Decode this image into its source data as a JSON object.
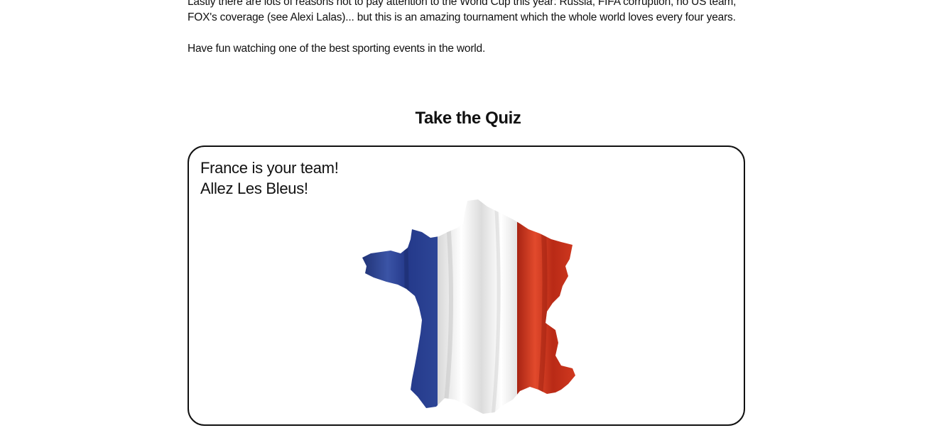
{
  "article": {
    "paragraph_1": "Lastly there are lots of reasons not to pay attention to the World Cup this year: Russia, FIFA corruption, no US team, FOX's coverage (see Alexi Lalas)... but this is an amazing tournament which the whole world loves every four years.",
    "paragraph_2": "Have fun watching one of the best sporting events in the world."
  },
  "quiz": {
    "heading": "Take the Quiz",
    "result_line_1": "France is your team!",
    "result_line_2": "Allez Les Bleus!",
    "image": {
      "icon": "france-flag-map",
      "colors": {
        "blue": "#2b3f8c",
        "white": "#f2f2f2",
        "red": "#c8321a"
      }
    }
  }
}
